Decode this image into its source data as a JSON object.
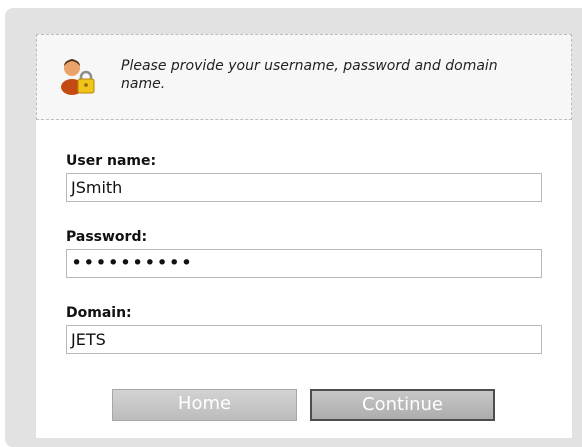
{
  "notice": {
    "icon": "user-lock-icon",
    "text": "Please provide your username, password and domain name."
  },
  "fields": {
    "username": {
      "label": "User name:",
      "value": "JSmith"
    },
    "password": {
      "label": "Password:",
      "masked_value": "••••••••••"
    },
    "domain": {
      "label": "Domain:",
      "value": "JETS"
    }
  },
  "buttons": {
    "home": "Home",
    "continue": "Continue"
  }
}
